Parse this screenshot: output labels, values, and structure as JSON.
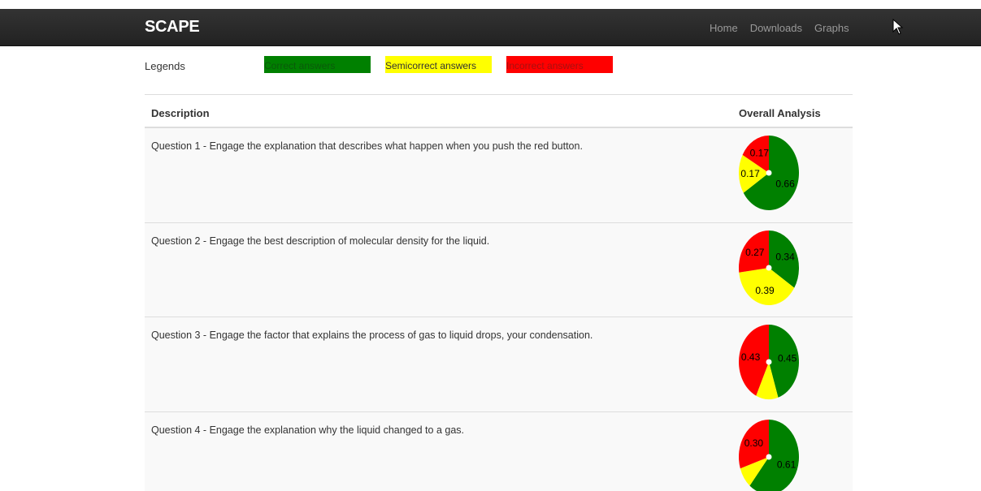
{
  "navbar": {
    "brand": "SCAPE",
    "links": [
      "Home",
      "Downloads",
      "Graphs"
    ]
  },
  "legend": {
    "title": "Legends",
    "items": [
      {
        "label": "Correct answers",
        "color": "#008000",
        "text_color": "#0a5a0a"
      },
      {
        "label": "Semicorrect answers",
        "color": "#ffff00",
        "text_color": "#333333"
      },
      {
        "label": "Incorrect answers",
        "color": "#ff0000",
        "text_color": "#a81010"
      }
    ]
  },
  "table": {
    "headers": {
      "description": "Description",
      "analysis": "Overall Analysis"
    },
    "rows": [
      {
        "text": "Question 1 - Engage the explanation that describes what happen when you push the red button.",
        "correct": 0.66,
        "semicorrect": 0.17,
        "incorrect": 0.17,
        "labels": {
          "correct": "0.66",
          "semicorrect": "0.17",
          "incorrect": "0.17"
        }
      },
      {
        "text": "Question 2 - Engage the best description of molecular density for the liquid.",
        "correct": 0.34,
        "semicorrect": 0.39,
        "incorrect": 0.27,
        "labels": {
          "correct": "0.34",
          "semicorrect": "0.39",
          "incorrect": "0.27"
        }
      },
      {
        "text": "Question 3 - Engage the factor that explains the process of gas to liquid drops, your condensation.",
        "correct": 0.45,
        "semicorrect": 0.12,
        "incorrect": 0.43,
        "labels": {
          "correct": "0.45",
          "semicorrect": "",
          "incorrect": "0.43"
        }
      },
      {
        "text": "Question 4 - Engage the explanation why the liquid changed to a gas.",
        "correct": 0.61,
        "semicorrect": 0.09,
        "incorrect": 0.3,
        "labels": {
          "correct": "0.61",
          "semicorrect": "",
          "incorrect": "0.30"
        }
      }
    ]
  },
  "colors": {
    "correct": "#008000",
    "semicorrect": "#ffff00",
    "incorrect": "#ff0000"
  }
}
